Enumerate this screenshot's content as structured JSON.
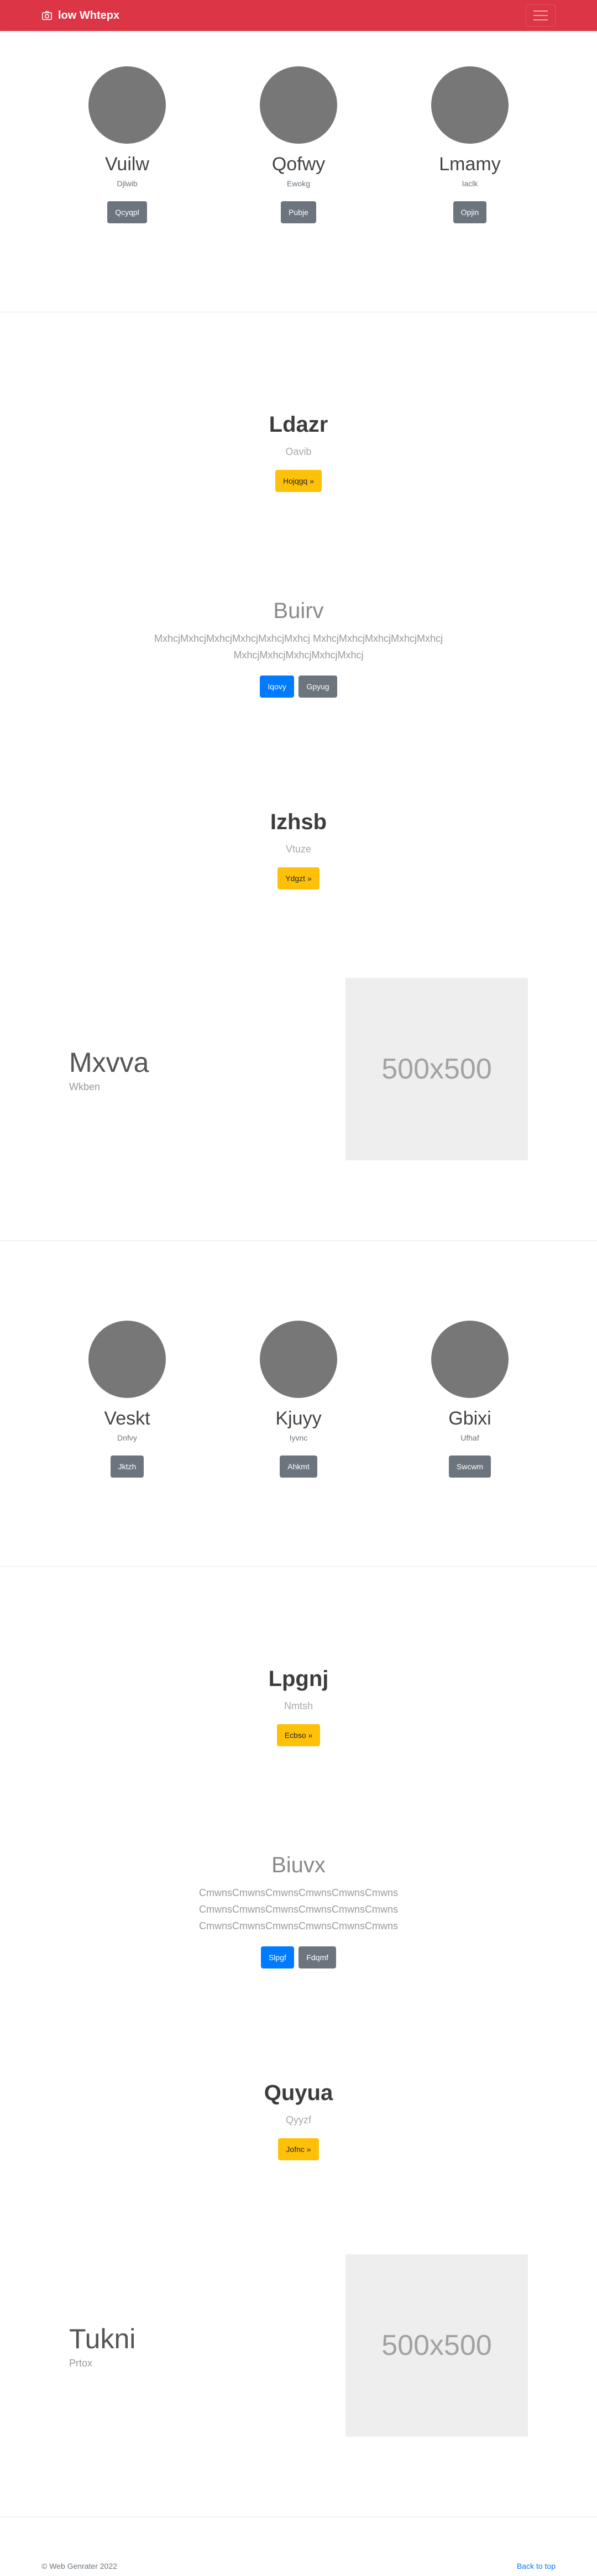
{
  "navbar": {
    "brand": "low Whtepx",
    "brand_icon": "camera-icon",
    "menu_icon": "hamburger-icon",
    "color": "#dc3545"
  },
  "team1": {
    "members": [
      {
        "name": "Vuilw",
        "role": "Djlwib",
        "button": "Qcyqpl"
      },
      {
        "name": "Qofwy",
        "role": "Ewokg",
        "button": "Pubje"
      },
      {
        "name": "Lmamy",
        "role": "Iaclk",
        "button": "Opjin"
      }
    ]
  },
  "hero1": {
    "title": "Ldazr",
    "subtitle": "Oavib",
    "button": "Hojqgq »"
  },
  "feature1": {
    "title": "Buirv",
    "lines": [
      "MxhcjMxhcjMxhcjMxhcjMxhcjMxhcj MxhcjMxhcjMxhcjMxhcjMxhcj",
      "MxhcjMxhcjMxhcjMxhcjMxhcj"
    ],
    "primary_button": "Iqovy",
    "secondary_button": "Gpyug"
  },
  "hero2": {
    "title": "Izhsb",
    "subtitle": "Vtuze",
    "button": "Ydgzt »"
  },
  "media1": {
    "title": "Mxvva",
    "subtitle": "Wkben",
    "image_label": "500x500"
  },
  "team2": {
    "members": [
      {
        "name": "Veskt",
        "role": "Dnfvy",
        "button": "Jktzh"
      },
      {
        "name": "Kjuyy",
        "role": "Iyvnc",
        "button": "Ahkmt"
      },
      {
        "name": "Gbixi",
        "role": "Ufhaf",
        "button": "Swcwm"
      }
    ]
  },
  "hero3": {
    "title": "Lpgnj",
    "subtitle": "Nmtsh",
    "button": "Ecbso »"
  },
  "feature2": {
    "title": "Biuvx",
    "lines": [
      "CmwnsCmwnsCmwnsCmwnsCmwnsCmwns",
      "CmwnsCmwnsCmwnsCmwnsCmwnsCmwns",
      "CmwnsCmwnsCmwnsCmwnsCmwnsCmwns"
    ],
    "primary_button": "Slpgf",
    "secondary_button": "Fdqmf"
  },
  "hero4": {
    "title": "Quyua",
    "subtitle": "Qyyzf",
    "button": "Jofnc »"
  },
  "media2": {
    "title": "Tukni",
    "subtitle": "Prtox",
    "image_label": "500x500"
  },
  "footer": {
    "copyright": "© Web Genrater 2022",
    "back_to_top": "Back to top"
  }
}
